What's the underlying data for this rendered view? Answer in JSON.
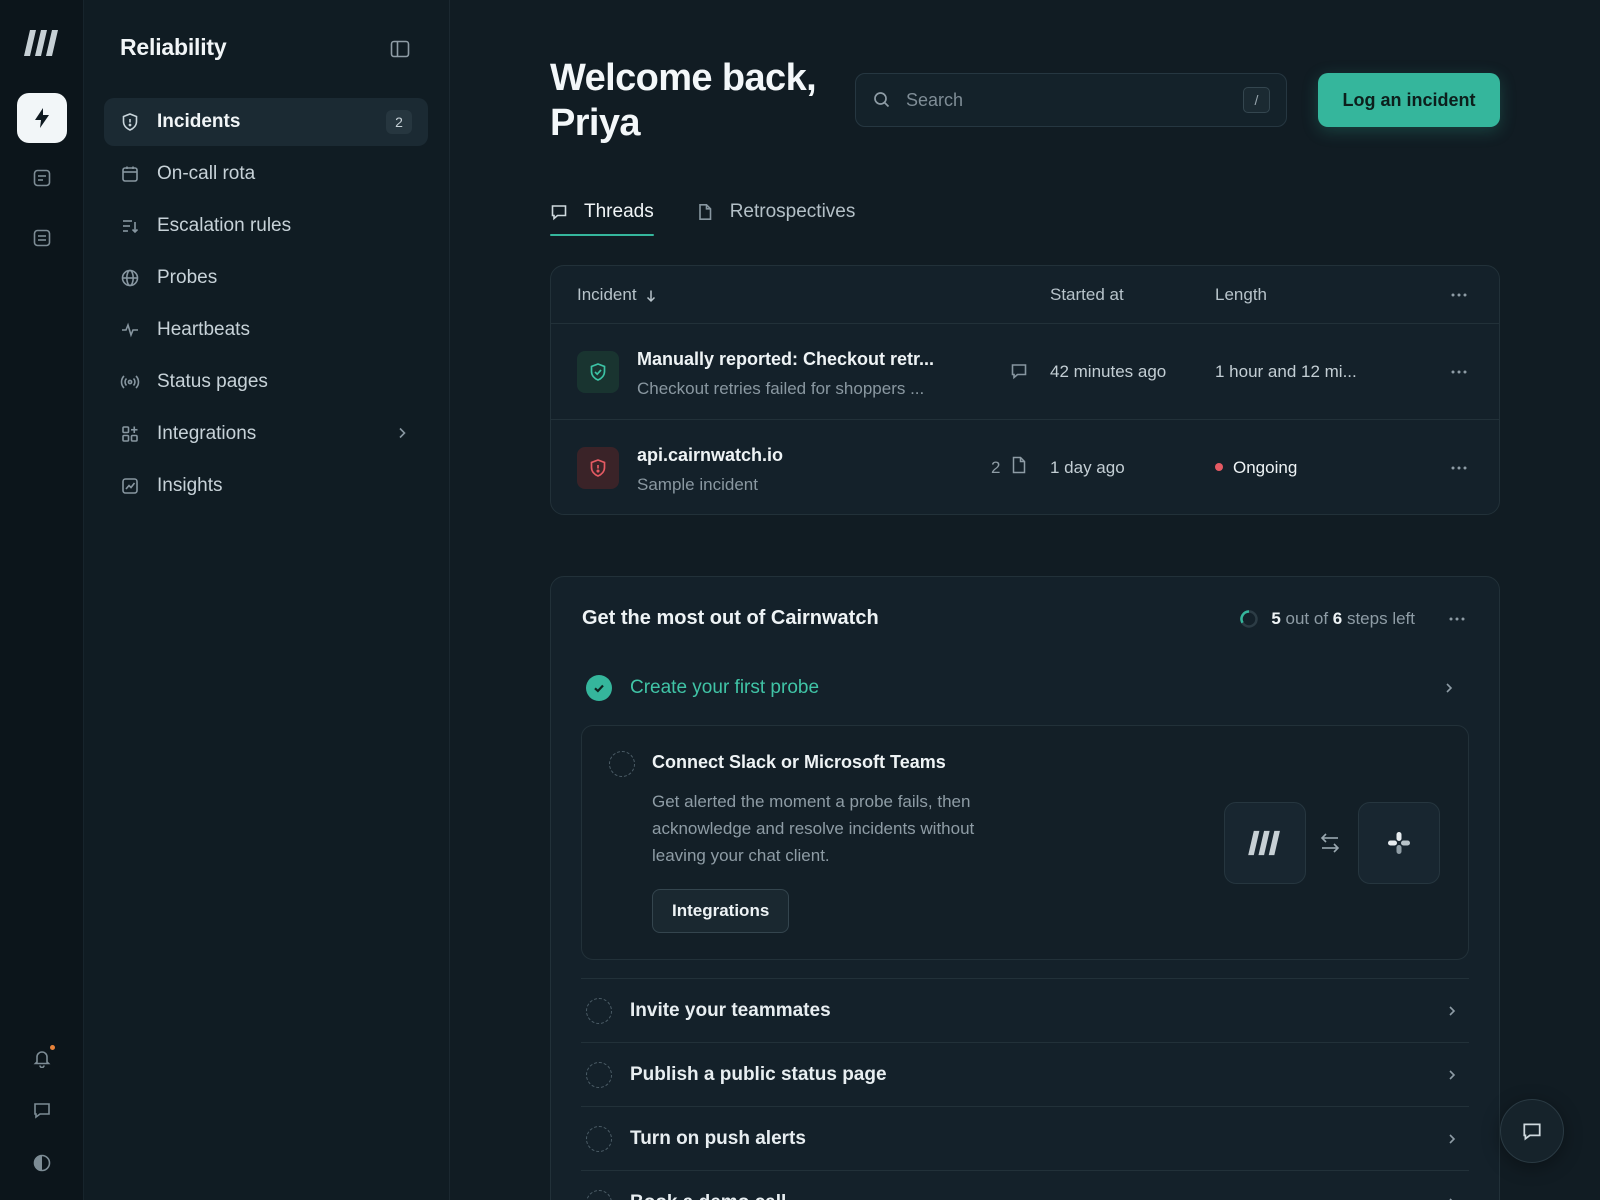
{
  "sidebar": {
    "title": "Reliability",
    "items": [
      {
        "label": "Incidents",
        "badge": "2",
        "icon": "shield-icon",
        "active": true
      },
      {
        "label": "On-call rota",
        "icon": "calendar-icon"
      },
      {
        "label": "Escalation rules",
        "icon": "list-sort-icon"
      },
      {
        "label": "Probes",
        "icon": "globe-icon"
      },
      {
        "label": "Heartbeats",
        "icon": "pulse-icon"
      },
      {
        "label": "Status pages",
        "icon": "broadcast-icon"
      },
      {
        "label": "Integrations",
        "icon": "grid-plus-icon",
        "has_submenu": true
      },
      {
        "label": "Insights",
        "icon": "chart-icon"
      }
    ]
  },
  "header": {
    "welcome": "Welcome back, Priya",
    "search_placeholder": "Search",
    "search_shortcut": "/",
    "primary_button": "Log an incident"
  },
  "tabs": [
    {
      "label": "Threads",
      "active": true,
      "icon": "comment-icon"
    },
    {
      "label": "Retrospectives",
      "active": false,
      "icon": "document-icon"
    }
  ],
  "incidents_table": {
    "columns": [
      "Incident",
      "Started at",
      "Length"
    ],
    "rows": [
      {
        "title": "Manually reported: Checkout retr...",
        "subtitle": "Checkout retries failed for shoppers ...",
        "started": "42 minutes ago",
        "length": "1 hour and 12 mi...",
        "state": "resolved",
        "attachment_icon": "comment-icon"
      },
      {
        "title": "api.cairnwatch.io",
        "subtitle": "Sample incident",
        "attachment_count": "2",
        "attachment_icon": "document-icon",
        "started": "1 day ago",
        "length": "Ongoing",
        "state": "ongoing"
      }
    ]
  },
  "onboarding": {
    "title": "Get the most out of Cairnwatch",
    "progress": {
      "left": "5",
      "total": "6",
      "mid": " out of ",
      "suffix": " steps left"
    },
    "done_step": "Create your first probe",
    "expanded": {
      "title": "Connect Slack or Microsoft Teams",
      "description": "Get alerted the moment a probe fails, then acknowledge and resolve incidents without leaving your chat client.",
      "button": "Integrations"
    },
    "steps": [
      "Invite your teammates",
      "Publish a public status page",
      "Turn on push alerts",
      "Book a demo call"
    ]
  },
  "colors": {
    "accent": "#35b69c",
    "danger": "#e45a63",
    "background": "#111c23",
    "notification_dot": "#e8823a"
  }
}
